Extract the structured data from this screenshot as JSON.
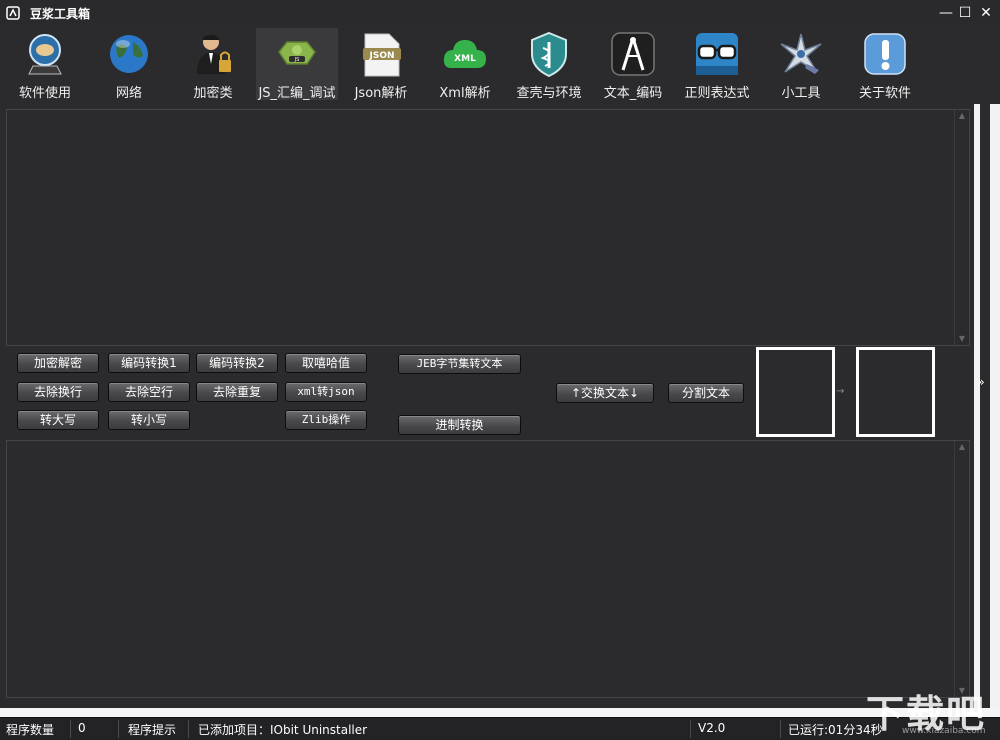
{
  "window": {
    "title": "豆浆工具箱",
    "minimize": "—",
    "maximize": "☐",
    "close": "✕"
  },
  "toolbar": {
    "items": [
      {
        "label": "软件使用",
        "icon": "gear-globe-icon"
      },
      {
        "label": "网络",
        "icon": "globe-icon"
      },
      {
        "label": "加密类",
        "icon": "person-lock-icon"
      },
      {
        "label": "JS_汇编_调试",
        "icon": "js-badge-icon",
        "active": true
      },
      {
        "label": "Json解析",
        "icon": "json-file-icon"
      },
      {
        "label": "Xml解析",
        "icon": "xml-cloud-icon"
      },
      {
        "label": "查壳与环境",
        "icon": "shield-icon"
      },
      {
        "label": "文本_编码",
        "icon": "compass-icon"
      },
      {
        "label": "正则表达式",
        "icon": "glasses-icon"
      },
      {
        "label": "小工具",
        "icon": "shuriken-icon"
      },
      {
        "label": "关于软件",
        "icon": "info-icon"
      }
    ]
  },
  "buttons": {
    "encrypt_decrypt": "加密解密",
    "encode_convert1": "编码转换1",
    "encode_convert2": "编码转换2",
    "hash_value": "取嘻哈值",
    "jeb_bytes": "JEB字节集转文本",
    "remove_newline": "去除换行",
    "remove_blank_line": "去除空行",
    "remove_duplicate": "去除重复",
    "xml_to_json": "xml转json",
    "swap_text": "↑交换文本↓",
    "split_text": "分割文本",
    "to_upper": "转大写",
    "to_lower": "转小写",
    "zlib_op": "Zlib操作",
    "base_convert": "进制转换"
  },
  "preview": {
    "arrow": "→"
  },
  "side": {
    "expand": "»"
  },
  "statusbar": {
    "program_count_label": "程序数量",
    "program_count_value": "0",
    "hint_label": "程序提示",
    "hint_value": "已添加项目：IObit Uninstaller",
    "version": "V2.0",
    "runtime": "已运行:01分34秒"
  },
  "watermark": {
    "text": "下载吧",
    "url": "www.xiazaiba.com"
  },
  "colors": {
    "background": "#2b2a2d",
    "panel_border": "#454447",
    "button_top": "#6b6a6d",
    "button_bottom": "#3c3b3e",
    "text": "#ffffff"
  }
}
